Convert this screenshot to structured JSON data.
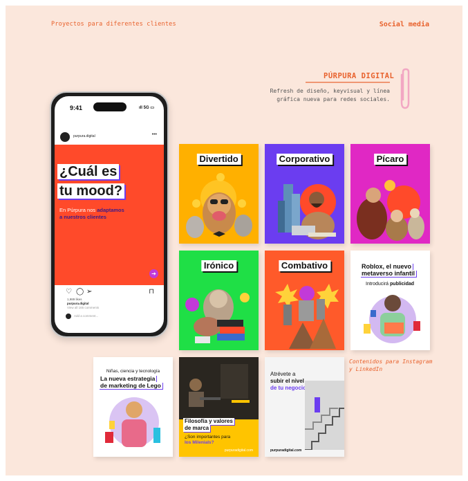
{
  "header": {
    "subtitle": "Proyectos para diferentes clientes",
    "section": "Social media"
  },
  "project": {
    "brand": "PÚRPURA DIGITAL",
    "description_line1": "Refresh de diseño, keyvisual y línea",
    "description_line2": "gráfica nueva para redes sociales."
  },
  "phone": {
    "time": "9:41",
    "signal": "5G",
    "username": "purpura.digital",
    "headline1": "¿Cuál es",
    "headline2": "tu mood?",
    "sub_plain": "En Púrpura nos ",
    "sub_bold1": "adaptamos",
    "sub_bold2": "a nuestros clientes",
    "likes": "1,989 likes",
    "caption_user": "purpura.digital",
    "comments": "View all 165 comments",
    "add_comment": "Add a comment..."
  },
  "cards": {
    "divertido": "Divertido",
    "corporativo": "Corporativo",
    "picaro": "Pícaro",
    "ironico": "Irónico",
    "combativo": "Combativo",
    "roblox_title1": "Roblox, el nuevo",
    "roblox_title2": "metaverso infantil",
    "roblox_sub_plain": "Introducirá ",
    "roblox_sub_bold": "publicidad",
    "lego_top": "Niñas, ciencia y tecnología",
    "lego_title1": "La nueva estrategia",
    "lego_title2": "de marketing de Lego",
    "filo_title1": "Filosofía y valores",
    "filo_title2": "de marca",
    "filo_sub1": "¿Son importantes para",
    "filo_sub2": "los Milenials?",
    "filo_link": "purpuradigital.com",
    "negocio1": "Atrévete a",
    "negocio2": "subir el nivel",
    "negocio3": "de tu negocio",
    "negocio_link": "purpuradigital.com"
  },
  "side_note": {
    "line1": "Contenidos para Instagram",
    "line2": "y LinkedIn"
  },
  "colors": {
    "accent": "#e8612c",
    "post_orange": "#ff4a2a",
    "purple": "#6b3df0"
  }
}
